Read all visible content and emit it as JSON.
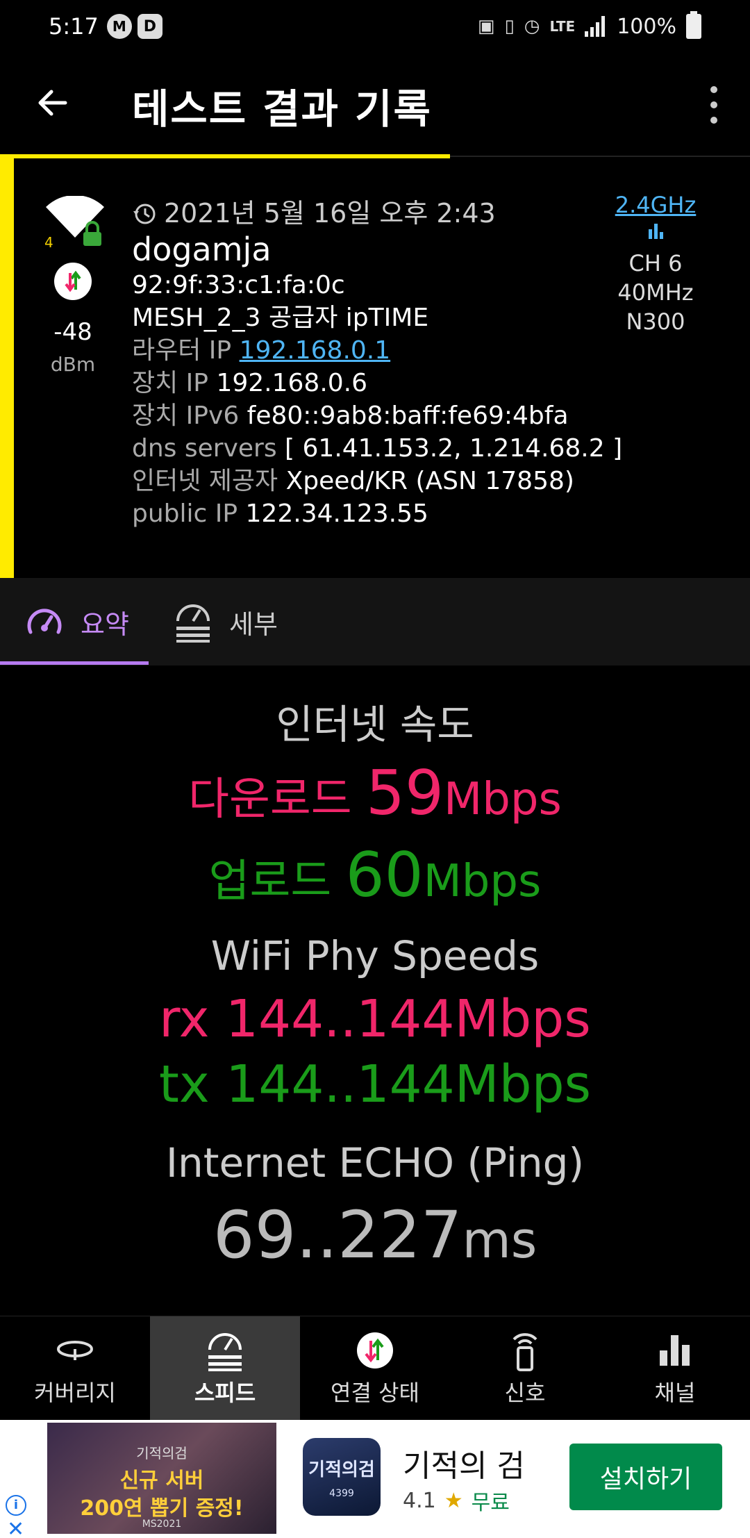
{
  "status_bar": {
    "time": "5:17",
    "icons": [
      "messenger-icon",
      "d-app-icon",
      "nfc-icon",
      "vibrate-icon",
      "alarm-icon",
      "lte-icon",
      "signal-icon",
      "battery-icon"
    ],
    "lte": "LTE",
    "battery": "100%"
  },
  "header": {
    "title": "테스트 결과 기록"
  },
  "record": {
    "signal": "-48",
    "signal_unit": "dBm",
    "wifi_level": "4",
    "date": "2021년 5월 16일 오후 2:43",
    "ssid": "dogamja",
    "bssid": "92:9f:33:c1:fa:0c",
    "vendor_prefix": "MESH_2_3 공급자 ",
    "vendor": "ipTIME",
    "router_label": "라우터 IP ",
    "router_ip": "192.168.0.1",
    "device_label": "장치 IP ",
    "device_ip": "192.168.0.6",
    "ipv6_label": "장치 IPv6 ",
    "ipv6": "fe80::9ab8:baff:fe69:4bfa",
    "dns_label": "dns servers ",
    "dns": "[ 61.41.153.2, 1.214.68.2 ]",
    "isp_label": "인터넷 제공자 ",
    "isp": "Xpeed/KR (ASN 17858)",
    "public_label": "public IP ",
    "public_ip": "122.34.123.55",
    "band": "2.4GHz",
    "channel": "CH 6",
    "width": "40MHz",
    "standard": "N300"
  },
  "tabs": {
    "summary": "요약",
    "detail": "세부"
  },
  "speed": {
    "heading": "인터넷 속도",
    "download_label": "다운로드 ",
    "download_value": "59",
    "download_unit": "Mbps",
    "upload_label": "업로드 ",
    "upload_value": "60",
    "upload_unit": "Mbps",
    "phy_heading": "WiFi Phy Speeds",
    "rx": "rx 144..144Mbps",
    "tx": "tx 144..144Mbps",
    "ping_heading": "Internet ECHO (Ping)",
    "ping_value": "69..227",
    "ping_unit": "ms"
  },
  "nav": {
    "coverage": "커버리지",
    "speed": "스피드",
    "connection": "연결 상태",
    "signal": "신호",
    "channel": "채널"
  },
  "ad": {
    "banner_line1": "기적의검",
    "banner_line2": "신규 서버",
    "banner_line3": "200연 뽑기 증정!",
    "banner_line4": "MS2021",
    "icon_text": "기적의검",
    "icon_publisher": "4399",
    "app_name": "기적의 검",
    "rating": "4.1",
    "price": "무료",
    "install": "설치하기"
  }
}
